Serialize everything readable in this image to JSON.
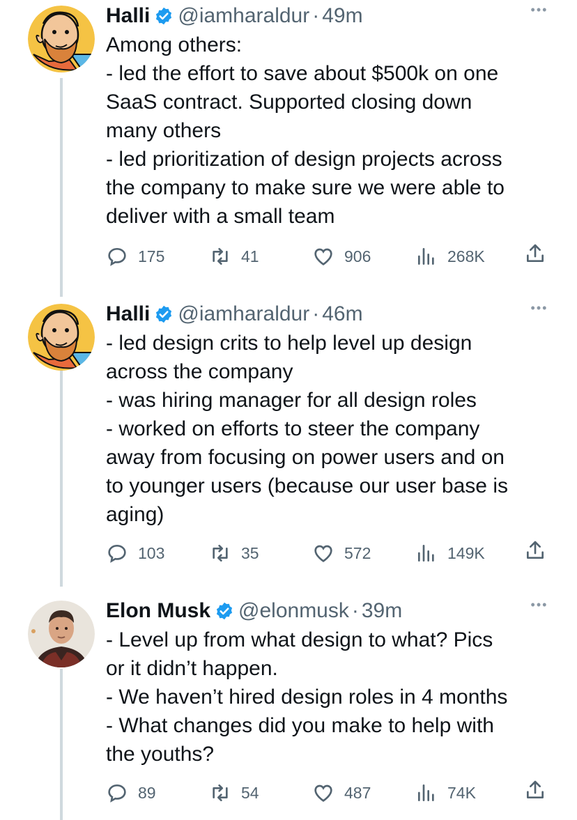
{
  "tweets": [
    {
      "author": "Halli",
      "handle": "@iamharaldur",
      "separator": "·",
      "time": "49m",
      "more": "•••",
      "lines": [
        "Among others:",
        "- led the effort to save about $500k on one",
        "SaaS contract. Supported closing down",
        "many others",
        "- led prioritization of design projects across",
        "the company to make sure we were able to",
        "deliver with a small team"
      ],
      "stats": {
        "replies": "175",
        "retweets": "41",
        "likes": "906",
        "views": "268K"
      },
      "avatar_icon": "cartoon-avatar-icon"
    },
    {
      "author": "Halli",
      "handle": "@iamharaldur",
      "separator": "·",
      "time": "46m",
      "more": "•••",
      "lines": [
        "- led design crits to help level up design",
        "across the company",
        "- was hiring manager for all design roles",
        "- worked on efforts to steer the company",
        "away from focusing on power users and on",
        "to younger users (because our user base is",
        "aging)"
      ],
      "stats": {
        "replies": "103",
        "retweets": "35",
        "likes": "572",
        "views": "149K"
      },
      "avatar_icon": "cartoon-avatar-icon"
    },
    {
      "author": "Elon Musk",
      "handle": "@elonmusk",
      "separator": "·",
      "time": "39m",
      "more": "•••",
      "lines": [
        "- Level up from what design to what? Pics",
        "or it didn’t happen.",
        "- We haven’t hired design roles in 4 months",
        "- What changes did you make to help with",
        "the youths?"
      ],
      "stats": {
        "replies": "89",
        "retweets": "54",
        "likes": "487",
        "views": "74K"
      },
      "avatar_icon": "photo-avatar-icon"
    }
  ],
  "colors": {
    "text": "#0f1419",
    "secondary": "#536471",
    "verified": "#1d9bf0",
    "thread_line": "#cfd9de",
    "halli_avatar_bg": "#f5c344"
  }
}
